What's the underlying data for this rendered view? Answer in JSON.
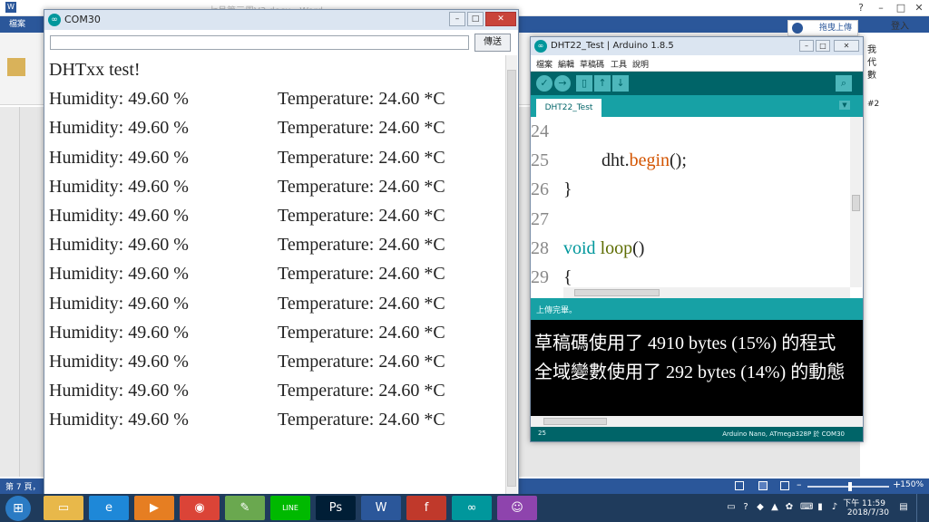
{
  "word": {
    "title": "七月第三周V3.docx - Word",
    "file_tab": "檔案",
    "upload_button": "拖曳上傳",
    "login_label": "登入",
    "status_page": "第 7 頁，",
    "zoom_level": "150%",
    "right_labels": [
      "我",
      "代",
      "數",
      "#2"
    ]
  },
  "serial_monitor": {
    "title": "COM30",
    "input_value": "",
    "send_button": "傳送",
    "minimize": "–",
    "restore": "□",
    "close": "✕",
    "lines": [
      {
        "text": "DHTxx test!"
      },
      {
        "humidity": "Humidity: 49.60 %",
        "temperature": "Temperature: 24.60 *C"
      },
      {
        "humidity": "Humidity: 49.60 %",
        "temperature": "Temperature: 24.60 *C"
      },
      {
        "humidity": "Humidity: 49.60 %",
        "temperature": "Temperature: 24.60 *C"
      },
      {
        "humidity": "Humidity: 49.60 %",
        "temperature": "Temperature: 24.60 *C"
      },
      {
        "humidity": "Humidity: 49.60 %",
        "temperature": "Temperature: 24.60 *C"
      },
      {
        "humidity": "Humidity: 49.60 %",
        "temperature": "Temperature: 24.60 *C"
      },
      {
        "humidity": "Humidity: 49.60 %",
        "temperature": "Temperature: 24.60 *C"
      },
      {
        "humidity": "Humidity: 49.60 %",
        "temperature": "Temperature: 24.60 *C"
      },
      {
        "humidity": "Humidity: 49.60 %",
        "temperature": "Temperature: 24.60 *C"
      },
      {
        "humidity": "Humidity: 49.60 %",
        "temperature": "Temperature: 24.60 *C"
      },
      {
        "humidity": "Humidity: 49.60 %",
        "temperature": "Temperature: 24.60 *C"
      },
      {
        "humidity": "Humidity: 49.60 %",
        "temperature": "Temperature: 24.60 *C"
      }
    ]
  },
  "arduino": {
    "title": "DHT22_Test | Arduino 1.8.5",
    "menu": [
      "檔案",
      "編輯",
      "草稿碼",
      "工具",
      "說明"
    ],
    "tab_label": "DHT22_Test",
    "code": {
      "l24": {
        "num": "24",
        "text": ""
      },
      "l25": {
        "num": "25",
        "obj": "dht",
        "dot": ".",
        "method": "begin",
        "rest": "();"
      },
      "l26": {
        "num": "26",
        "text": "}"
      },
      "l27": {
        "num": "27",
        "text": ""
      },
      "l28": {
        "num": "28",
        "type": "void",
        "space": " ",
        "func": "loop",
        "rest": "()"
      },
      "l29": {
        "num": "29",
        "text": "{"
      }
    },
    "status_message": "上傳完畢。",
    "console_lines": [
      "草稿碼使用了 4910 bytes (15%) 的程式",
      "全域變數使用了 292 bytes (14%) 的動態"
    ],
    "bottom_line": "25",
    "board_info": "Arduino Nano, ATmega328P 於 COM30"
  },
  "taskbar": {
    "time": "下午 11:59",
    "date": "2018/7/30",
    "apps": [
      {
        "icon": "folder-icon",
        "glyph": "▭",
        "color": "#e8b84a"
      },
      {
        "icon": "ie-icon",
        "glyph": "e",
        "color": "#1e88d8"
      },
      {
        "icon": "media-player-icon",
        "glyph": "▶",
        "color": "#e67e22"
      },
      {
        "icon": "chrome-icon",
        "glyph": "◉",
        "color": "#db4437"
      },
      {
        "icon": "notepad-icon",
        "glyph": "✎",
        "color": "#6aa84f"
      },
      {
        "icon": "line-icon",
        "glyph": "LINE",
        "color": "#00b900"
      },
      {
        "icon": "photoshop-icon",
        "glyph": "Ps",
        "color": "#001e36"
      },
      {
        "icon": "word-icon",
        "glyph": "W",
        "color": "#2b579a"
      },
      {
        "icon": "flash-icon",
        "glyph": "f",
        "color": "#c0392b"
      },
      {
        "icon": "arduino-icon",
        "glyph": "∞",
        "color": "#00979c"
      },
      {
        "icon": "cat-icon",
        "glyph": "☺",
        "color": "#8e44ad"
      }
    ]
  }
}
